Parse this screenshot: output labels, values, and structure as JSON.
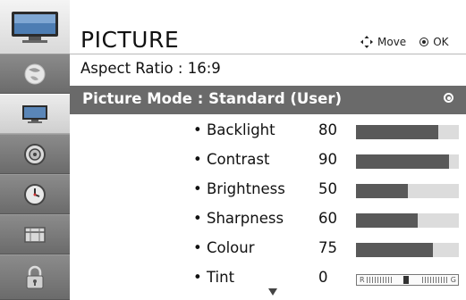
{
  "header": {
    "title": "PICTURE",
    "move_label": "Move",
    "ok_label": "OK"
  },
  "sidebar": {
    "items": [
      {
        "icon": "picture-icon",
        "active": true,
        "position": "top"
      },
      {
        "icon": "sphere-icon"
      },
      {
        "icon": "picture-icon",
        "active": true
      },
      {
        "icon": "speaker-icon"
      },
      {
        "icon": "clock-icon"
      },
      {
        "icon": "lock-icon"
      }
    ]
  },
  "aspect_ratio": {
    "label": "Aspect Ratio",
    "value": ": 16:9"
  },
  "picture_mode": {
    "label": "Picture Mode : Standard (User)"
  },
  "settings": [
    {
      "label": "• Backlight",
      "value": "80",
      "level": 0.8
    },
    {
      "label": "• Contrast",
      "value": "90",
      "level": 0.9
    },
    {
      "label": "• Brightness",
      "value": "50",
      "level": 0.5
    },
    {
      "label": "• Sharpness",
      "value": "60",
      "level": 0.6
    },
    {
      "label": "• Colour",
      "value": "75",
      "level": 0.75
    },
    {
      "label": "• Tint",
      "value": "0",
      "r_label": "R",
      "g_label": "G"
    }
  ],
  "colors": {
    "selected_row": "#6a6a6a",
    "bar_fill": "#595959",
    "bar_track": "#dcdcdc"
  }
}
